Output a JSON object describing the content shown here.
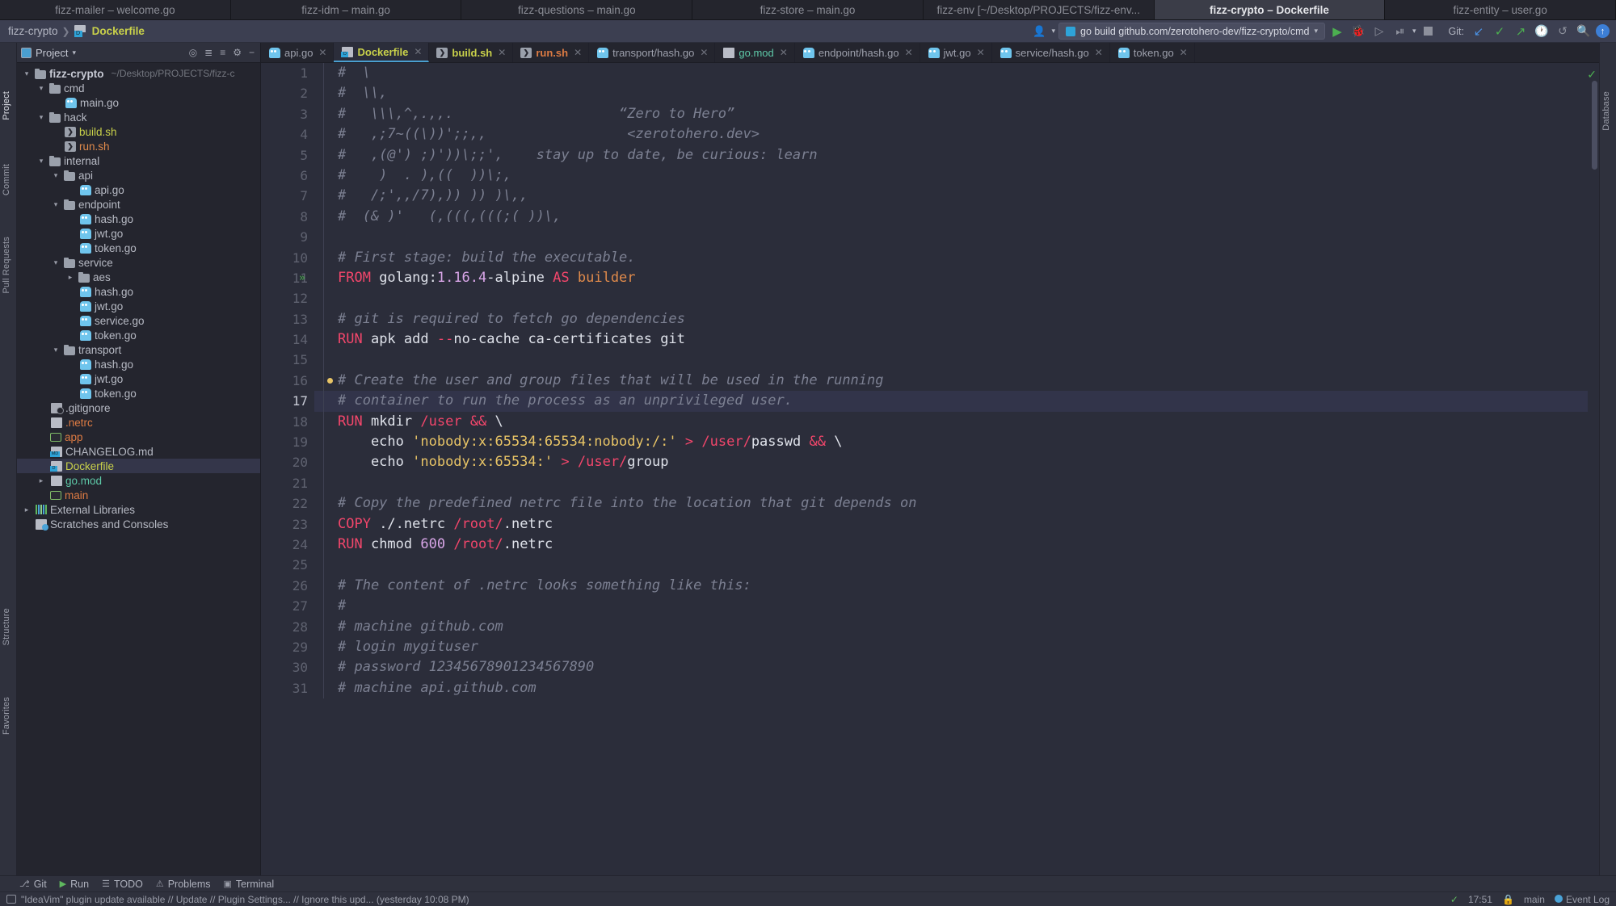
{
  "window_tabs": [
    {
      "label": "fizz-mailer – welcome.go",
      "active": false
    },
    {
      "label": "fizz-idm – main.go",
      "active": false
    },
    {
      "label": "fizz-questions – main.go",
      "active": false
    },
    {
      "label": "fizz-store – main.go",
      "active": false
    },
    {
      "label": "fizz-env [~/Desktop/PROJECTS/fizz-env...",
      "active": false
    },
    {
      "label": "fizz-crypto – Dockerfile",
      "active": true
    },
    {
      "label": "fizz-entity – user.go",
      "active": false
    }
  ],
  "navbar": {
    "breadcrumb_project": "fizz-crypto",
    "breadcrumb_sep": "❯",
    "breadcrumb_file": "Dockerfile",
    "run_config": "go build github.com/zerotohero-dev/fizz-crypto/cmd",
    "run_config_caret": "▾",
    "git_label": "Git:",
    "icons": {
      "user": "user-avatar-icon",
      "run": "▶",
      "debug": "debug-icon",
      "coverage": "coverage-icon",
      "profile": "profile-icon",
      "dropdown": "▾",
      "stop": "stop-icon",
      "git_update": "↙",
      "git_commit": "✔",
      "git_push": "↗",
      "git_history": "🕐",
      "git_rollback": "↺",
      "search": "search-icon",
      "updates": "↑"
    }
  },
  "left_rail": [
    {
      "label": "Project",
      "selected": true
    },
    {
      "label": "Commit",
      "selected": false
    },
    {
      "label": "Pull Requests",
      "selected": false
    },
    {
      "label": "Structure",
      "selected": false
    },
    {
      "label": "Favorites",
      "selected": false
    }
  ],
  "right_rail": [
    {
      "label": "Database",
      "selected": false
    }
  ],
  "project_panel": {
    "title": "Project",
    "title_caret": "▾",
    "tools": [
      "locate-icon",
      "expand-all-icon",
      "collapse-all-icon",
      "settings-icon",
      "hide-icon"
    ],
    "tree": [
      {
        "depth": 0,
        "arrow": "v",
        "icon": "folder",
        "label": "fizz-crypto",
        "style": "bold",
        "path": "~/Desktop/PROJECTS/fizz-c"
      },
      {
        "depth": 1,
        "arrow": "v",
        "icon": "folder",
        "label": "cmd",
        "style": ""
      },
      {
        "depth": 2,
        "arrow": "",
        "icon": "go",
        "label": "main.go",
        "style": ""
      },
      {
        "depth": 1,
        "arrow": "v",
        "icon": "folder",
        "label": "hack",
        "style": ""
      },
      {
        "depth": 2,
        "arrow": "",
        "icon": "sh",
        "label": "build.sh",
        "style": "yellowgreen"
      },
      {
        "depth": 2,
        "arrow": "",
        "icon": "sh",
        "label": "run.sh",
        "style": "orange"
      },
      {
        "depth": 1,
        "arrow": "v",
        "icon": "folder",
        "label": "internal",
        "style": ""
      },
      {
        "depth": 2,
        "arrow": "v",
        "icon": "folder",
        "label": "api",
        "style": ""
      },
      {
        "depth": 3,
        "arrow": "",
        "icon": "go",
        "label": "api.go",
        "style": ""
      },
      {
        "depth": 2,
        "arrow": "v",
        "icon": "folder",
        "label": "endpoint",
        "style": ""
      },
      {
        "depth": 3,
        "arrow": "",
        "icon": "go",
        "label": "hash.go",
        "style": ""
      },
      {
        "depth": 3,
        "arrow": "",
        "icon": "go",
        "label": "jwt.go",
        "style": ""
      },
      {
        "depth": 3,
        "arrow": "",
        "icon": "go",
        "label": "token.go",
        "style": ""
      },
      {
        "depth": 2,
        "arrow": "v",
        "icon": "folder",
        "label": "service",
        "style": ""
      },
      {
        "depth": 3,
        "arrow": ">",
        "icon": "folder",
        "label": "aes",
        "style": ""
      },
      {
        "depth": 3,
        "arrow": "",
        "icon": "go",
        "label": "hash.go",
        "style": ""
      },
      {
        "depth": 3,
        "arrow": "",
        "icon": "go",
        "label": "jwt.go",
        "style": ""
      },
      {
        "depth": 3,
        "arrow": "",
        "icon": "go",
        "label": "service.go",
        "style": ""
      },
      {
        "depth": 3,
        "arrow": "",
        "icon": "go",
        "label": "token.go",
        "style": ""
      },
      {
        "depth": 2,
        "arrow": "v",
        "icon": "folder",
        "label": "transport",
        "style": ""
      },
      {
        "depth": 3,
        "arrow": "",
        "icon": "go",
        "label": "hash.go",
        "style": ""
      },
      {
        "depth": 3,
        "arrow": "",
        "icon": "go",
        "label": "jwt.go",
        "style": ""
      },
      {
        "depth": 3,
        "arrow": "",
        "icon": "go",
        "label": "token.go",
        "style": ""
      },
      {
        "depth": 1,
        "arrow": "",
        "icon": "gitignore",
        "label": ".gitignore",
        "style": ""
      },
      {
        "depth": 1,
        "arrow": "",
        "icon": "doc",
        "label": ".netrc",
        "style": "orange2"
      },
      {
        "depth": 1,
        "arrow": "",
        "icon": "exe",
        "label": "app",
        "style": "orange2"
      },
      {
        "depth": 1,
        "arrow": "",
        "icon": "md",
        "label": "CHANGELOG.md",
        "style": ""
      },
      {
        "depth": 1,
        "arrow": "",
        "icon": "dockerfile",
        "label": "Dockerfile",
        "style": "yellowgreen",
        "selected": true
      },
      {
        "depth": 1,
        "arrow": ">",
        "icon": "doc",
        "label": "go.mod",
        "style": "teal"
      },
      {
        "depth": 1,
        "arrow": "",
        "icon": "exe",
        "label": "main",
        "style": "orange2"
      },
      {
        "depth": 0,
        "arrow": ">",
        "icon": "lib",
        "label": "External Libraries",
        "style": ""
      },
      {
        "depth": 0,
        "arrow": "",
        "icon": "scratch",
        "label": "Scratches and Consoles",
        "style": ""
      }
    ]
  },
  "editor_tabs": [
    {
      "label": "api.go",
      "icon": "go",
      "style": "",
      "active": false
    },
    {
      "label": "Dockerfile",
      "icon": "dockerfile",
      "style": "yellowgreen",
      "active": true
    },
    {
      "label": "build.sh",
      "icon": "sh",
      "style": "yellowgreen",
      "active": false
    },
    {
      "label": "run.sh",
      "icon": "sh",
      "style": "orange",
      "active": false
    },
    {
      "label": "transport/hash.go",
      "icon": "go",
      "style": "",
      "active": false
    },
    {
      "label": "go.mod",
      "icon": "gomod",
      "style": "teal",
      "active": false
    },
    {
      "label": "endpoint/hash.go",
      "icon": "go",
      "style": "",
      "active": false
    },
    {
      "label": "jwt.go",
      "icon": "go",
      "style": "",
      "active": false
    },
    {
      "label": "service/hash.go",
      "icon": "go",
      "style": "",
      "active": false
    },
    {
      "label": "token.go",
      "icon": "go",
      "style": "",
      "active": false
    }
  ],
  "editor": {
    "current_line": 17,
    "first_line": 1,
    "lines": [
      {
        "n": 1,
        "tokens": [
          {
            "t": "#  \\",
            "c": "cmt"
          }
        ]
      },
      {
        "n": 2,
        "tokens": [
          {
            "t": "#  \\\\,",
            "c": "cmt"
          }
        ]
      },
      {
        "n": 3,
        "tokens": [
          {
            "t": "#   \\\\\\,^,.,,.                    “Zero to Hero”",
            "c": "cmt"
          }
        ]
      },
      {
        "n": 4,
        "tokens": [
          {
            "t": "#   ,;7~((\\))';;,,                 <zerotohero.dev>",
            "c": "cmt"
          }
        ]
      },
      {
        "n": 5,
        "tokens": [
          {
            "t": "#   ,(@') ;)'))\\;;',    stay up to date, be curious: learn",
            "c": "cmt"
          }
        ]
      },
      {
        "n": 6,
        "tokens": [
          {
            "t": "#    )  . ),((  ))\\;,",
            "c": "cmt"
          }
        ]
      },
      {
        "n": 7,
        "tokens": [
          {
            "t": "#   /;',,/7),)) )) )\\,,",
            "c": "cmt"
          }
        ]
      },
      {
        "n": 8,
        "tokens": [
          {
            "t": "#  (& )'   (,(((,(((;( ))\\,",
            "c": "cmt"
          }
        ]
      },
      {
        "n": 9,
        "tokens": []
      },
      {
        "n": 10,
        "tokens": [
          {
            "t": "# First stage: build the executable.",
            "c": "cmt"
          }
        ]
      },
      {
        "n": 11,
        "marker": "»",
        "fold": true,
        "tokens": [
          {
            "t": "FROM",
            "c": "kw"
          },
          {
            "t": " golang:",
            "c": "plain"
          },
          {
            "t": "1.16.4",
            "c": "num"
          },
          {
            "t": "-alpine",
            "c": "plain"
          },
          {
            "t": " AS",
            "c": "kw"
          },
          {
            "t": " builder",
            "c": "kw2"
          }
        ]
      },
      {
        "n": 12,
        "tokens": []
      },
      {
        "n": 13,
        "tokens": [
          {
            "t": "# git is required to fetch go dependencies",
            "c": "cmt"
          }
        ]
      },
      {
        "n": 14,
        "tokens": [
          {
            "t": "RUN",
            "c": "kw"
          },
          {
            "t": " apk add ",
            "c": "plain"
          },
          {
            "t": "--",
            "c": "kw"
          },
          {
            "t": "no-cache ca-certificates git",
            "c": "plain"
          }
        ]
      },
      {
        "n": 15,
        "tokens": []
      },
      {
        "n": 16,
        "bulb": true,
        "tokens": [
          {
            "t": "# Create the user and group files that will be used in the running",
            "c": "cmt"
          }
        ]
      },
      {
        "n": 17,
        "tokens": [
          {
            "t": "# container to run the process as an unprivileged user.",
            "c": "cmt"
          }
        ]
      },
      {
        "n": 18,
        "tokens": [
          {
            "t": "RUN",
            "c": "kw"
          },
          {
            "t": " mkdir ",
            "c": "plain"
          },
          {
            "t": "/user",
            "c": "pink"
          },
          {
            "t": " ",
            "c": "plain"
          },
          {
            "t": "&&",
            "c": "kw"
          },
          {
            "t": " \\",
            "c": "plain"
          }
        ]
      },
      {
        "n": 19,
        "tokens": [
          {
            "t": "    echo ",
            "c": "plain"
          },
          {
            "t": "'nobody:x:65534:65534:nobody:/:'",
            "c": "str"
          },
          {
            "t": " ",
            "c": "plain"
          },
          {
            "t": ">",
            "c": "kw"
          },
          {
            "t": " ",
            "c": "plain"
          },
          {
            "t": "/user/",
            "c": "pink"
          },
          {
            "t": "passwd ",
            "c": "plain"
          },
          {
            "t": "&&",
            "c": "kw"
          },
          {
            "t": " \\",
            "c": "plain"
          }
        ]
      },
      {
        "n": 20,
        "tokens": [
          {
            "t": "    echo ",
            "c": "plain"
          },
          {
            "t": "'nobody:x:65534:'",
            "c": "str"
          },
          {
            "t": " ",
            "c": "plain"
          },
          {
            "t": ">",
            "c": "kw"
          },
          {
            "t": " ",
            "c": "plain"
          },
          {
            "t": "/user/",
            "c": "pink"
          },
          {
            "t": "group",
            "c": "plain"
          }
        ]
      },
      {
        "n": 21,
        "tokens": []
      },
      {
        "n": 22,
        "tokens": [
          {
            "t": "# Copy the predefined netrc file into the location that git depends on",
            "c": "cmt"
          }
        ]
      },
      {
        "n": 23,
        "tokens": [
          {
            "t": "COPY",
            "c": "kw"
          },
          {
            "t": " ./",
            "c": "plain"
          },
          {
            "t": ".netrc ",
            "c": "plain"
          },
          {
            "t": "/root/",
            "c": "pink"
          },
          {
            "t": ".netrc",
            "c": "plain"
          }
        ]
      },
      {
        "n": 24,
        "tokens": [
          {
            "t": "RUN",
            "c": "kw"
          },
          {
            "t": " chmod ",
            "c": "plain"
          },
          {
            "t": "600",
            "c": "num"
          },
          {
            "t": " ",
            "c": "plain"
          },
          {
            "t": "/root/",
            "c": "pink"
          },
          {
            "t": ".netrc",
            "c": "plain"
          }
        ]
      },
      {
        "n": 25,
        "tokens": []
      },
      {
        "n": 26,
        "tokens": [
          {
            "t": "# The content of .netrc looks something like this:",
            "c": "cmt"
          }
        ]
      },
      {
        "n": 27,
        "tokens": [
          {
            "t": "#",
            "c": "cmt"
          }
        ]
      },
      {
        "n": 28,
        "tokens": [
          {
            "t": "# machine github.com",
            "c": "cmt"
          }
        ]
      },
      {
        "n": 29,
        "tokens": [
          {
            "t": "# login mygituser",
            "c": "cmt"
          }
        ]
      },
      {
        "n": 30,
        "tokens": [
          {
            "t": "# password 12345678901234567890",
            "c": "cmt"
          }
        ]
      },
      {
        "n": 31,
        "tokens": [
          {
            "t": "# machine api.github.com",
            "c": "cmt"
          }
        ]
      }
    ]
  },
  "bottom_toolbar": [
    {
      "label": "Git",
      "icon": "git-icon"
    },
    {
      "label": "Run",
      "icon": "run-icon"
    },
    {
      "label": "TODO",
      "icon": "todo-icon"
    },
    {
      "label": "Problems",
      "icon": "problems-icon"
    },
    {
      "label": "Terminal",
      "icon": "terminal-icon"
    }
  ],
  "statusbar": {
    "message": "\"IdeaVim\" plugin update available // Update // Plugin Settings... // Ignore this upd... (yesterday 10:08 PM)",
    "time": "17:51",
    "branch": "main",
    "event_log": "Event Log",
    "lock_icon": "lock-icon",
    "git_icon": "git-branch-icon"
  },
  "colors": {
    "accent": "#4a9fd0",
    "keyword": "#f2466b",
    "string": "#e8c466",
    "comment": "#7c8092",
    "number": "#d9a6e8",
    "bg": "#2b2d3a"
  }
}
